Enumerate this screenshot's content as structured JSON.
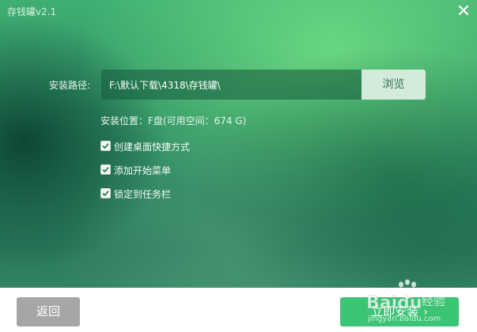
{
  "app": {
    "title": "存钱罐v2.1"
  },
  "form": {
    "path_label": "安装路径:",
    "path_value": "F:\\默认下载\\4318\\存钱罐\\",
    "browse_label": "浏览",
    "install_info": "安装位置：F盘(可用空间：674 G)"
  },
  "options": [
    {
      "label": "创建桌面快捷方式",
      "checked": true
    },
    {
      "label": "添加开始菜单",
      "checked": true
    },
    {
      "label": "锁定到任务栏",
      "checked": true
    }
  ],
  "footer": {
    "back_label": "返回",
    "install_label": "立即安装",
    "install_arrow": "›"
  },
  "watermark": {
    "brand": "Baidu",
    "suffix": "经验",
    "url": "jingyan.baidu.com"
  },
  "colors": {
    "accent": "#3bc473",
    "browse_text": "#2e7650"
  }
}
